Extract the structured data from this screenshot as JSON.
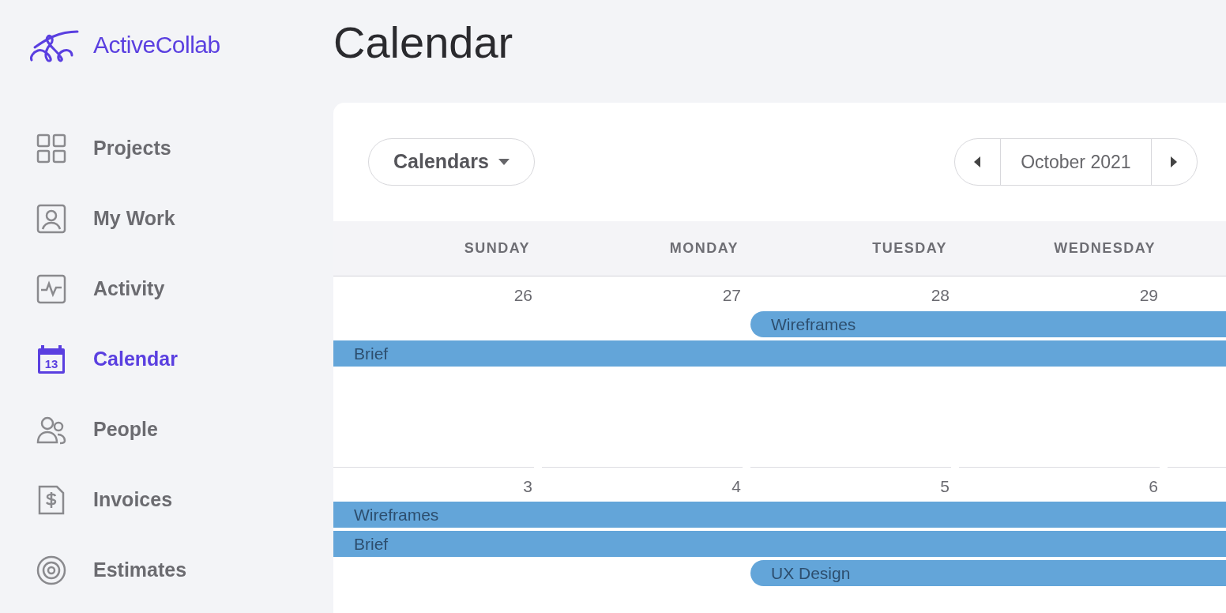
{
  "brand": {
    "name": "ActiveCollab"
  },
  "sidebar": {
    "items": [
      {
        "label": "Projects",
        "kind": "grid",
        "selected": false
      },
      {
        "label": "My Work",
        "kind": "person",
        "selected": false
      },
      {
        "label": "Activity",
        "kind": "pulse",
        "selected": false
      },
      {
        "label": "Calendar",
        "kind": "calendar",
        "icon_text": "13",
        "selected": true
      },
      {
        "label": "People",
        "kind": "people",
        "selected": false
      },
      {
        "label": "Invoices",
        "kind": "invoice",
        "selected": false
      },
      {
        "label": "Estimates",
        "kind": "target",
        "selected": false
      }
    ]
  },
  "page_title": "Calendar",
  "toolbar": {
    "calendars_button": "Calendars",
    "month": "October 2021"
  },
  "days": [
    "SUNDAY",
    "MONDAY",
    "TUESDAY",
    "WEDNESDAY"
  ],
  "weeks": [
    {
      "dates": [
        "26",
        "27",
        "28",
        "29"
      ],
      "events": [
        {
          "title": "Wireframes",
          "continues_from_before": false
        },
        {
          "title": "Brief",
          "continues_from_before": true
        }
      ]
    },
    {
      "dates": [
        "3",
        "4",
        "5",
        "6"
      ],
      "events": [
        {
          "title": "Wireframes",
          "continues_from_before": true
        },
        {
          "title": "Brief",
          "continues_from_before": true
        },
        {
          "title": "UX Design",
          "continues_from_before": false
        }
      ]
    }
  ]
}
